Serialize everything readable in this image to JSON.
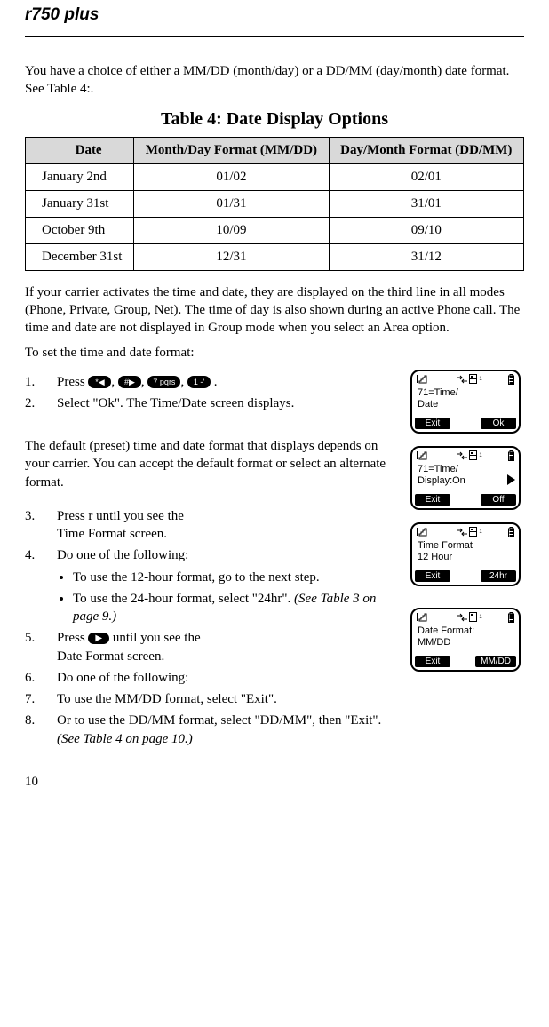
{
  "header": {
    "model": "r750",
    "suffix": "plus"
  },
  "intro": "You have a choice of either a MM/DD (month/day) or a DD/MM (day/month) date format. See Table 4:.",
  "table": {
    "title": "Table 4: Date Display Options",
    "headers": [
      "Date",
      "Month/Day Format (MM/DD)",
      "Day/Month Format (DD/MM)"
    ],
    "rows": [
      [
        "January 2nd",
        "01/02",
        "02/01"
      ],
      [
        "January 31st",
        "01/31",
        "31/01"
      ],
      [
        "October 9th",
        "10/09",
        "09/10"
      ],
      [
        "December 31st",
        "12/31",
        "31/12"
      ]
    ]
  },
  "para2": "If your carrier activates the time and date, they are displayed on the third line in all modes (Phone, Private, Group, Net). The time of day is also shown during an active Phone call. The time and date are not displayed in Group mode when you select an Area option.",
  "para3": "To set the time and date format:",
  "step1_parts": {
    "a": "Press",
    "keys": [
      "*◀",
      "#▶",
      "7 pqrs",
      "1 -'"
    ],
    "z": "."
  },
  "step2": "Select \"Ok\". The Time/Date screen displays.",
  "para4": "The default (preset) time and date format that displays depends on your carrier. You can accept the default format or select an alternate format.",
  "step3": {
    "a": "Press r until you see the",
    "b": "Time Format screen."
  },
  "step4": "Do one of the following:",
  "bullets4": [
    {
      "t": "To use the 12-hour format, go to the next step."
    },
    {
      "t": "To use the 24-hour format, select \"24hr\". ",
      "i": "(See Table 3 on page 9.)"
    }
  ],
  "step5": {
    "a": "Press ",
    "key": "▶",
    "b": " until you see the",
    "c": "Date Format screen."
  },
  "step6": "Do one of the following:",
  "step7": "To use the MM/DD format, select \"Exit\".",
  "step8": {
    "a": "Or to use the DD/MM format, select \"DD/MM\", then \"Exit\". ",
    "i": "(See Table 4 on page 10.)"
  },
  "screens": [
    {
      "line1": "71=Time/",
      "line2": "Date",
      "left": "Exit",
      "right": "Ok",
      "tri": false
    },
    {
      "line1": "71=Time/",
      "line2": "Display:On",
      "left": "Exit",
      "right": "Off",
      "tri": true
    },
    {
      "line1": "Time Format",
      "line2": "12 Hour",
      "left": "Exit",
      "right": "24hr",
      "tri": false
    },
    {
      "line1": "Date Format:",
      "line2": "MM/DD",
      "left": "Exit",
      "right": "MM/DD",
      "tri": false
    }
  ],
  "status_sup": "1",
  "pagenum": "10"
}
